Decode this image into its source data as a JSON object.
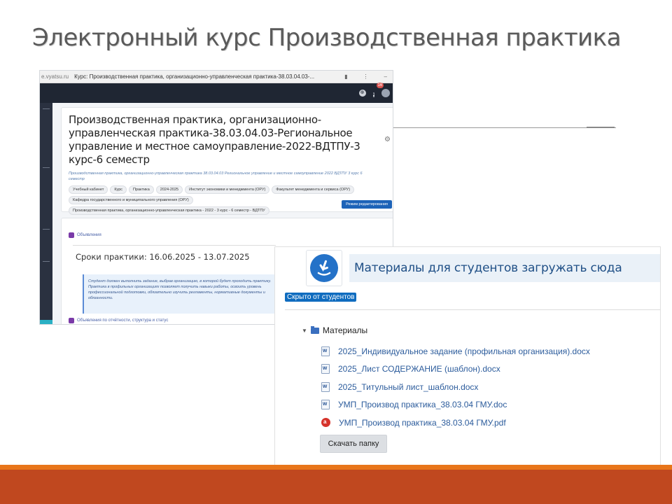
{
  "slide": {
    "title": "Электронный курс Производственная практика"
  },
  "browser": {
    "url": "e.vyatsu.ru",
    "tab_title": "Курс: Производственная практика, организационно-управленческая практика-38.03.04.03-...",
    "notification_count": "16"
  },
  "course": {
    "name": "Производственная практика, организационно-управленческая практика-38.03.04.03-Региональное управление и местное самоуправление-2022-ВДТПУ-3 курс-6 семестр",
    "subtitle": "Производственная практика, организационно-управленческая практика 38.03.04.03 Региональное управление и местное самоуправление 2022 ВДТПУ 3 курс 6 семестр",
    "chips": [
      "Учебный кабинет",
      "Курс",
      "Практика",
      "2024-2025",
      "Институт экономики и менеджмента (ОРУ)",
      "Факультет менеджмента и сервиса (ОРУ)",
      "Кафедра государственного и муниципального управления (ОРУ)",
      "Производственная практика, организационно-управленческая практика - 2022 - 3 курс - 6 семестр - ВДТПУ"
    ],
    "action_button": "Режим редактирования",
    "announcements_label": "Объявления",
    "dates_text": "Сроки практики: 16.06.2025 - 13.07.2025",
    "info_text": "Студент должен выполнить задание, выбрав организацию, в которой будет проходить практику. Практика в профильных организациях позволяет получить навыки работы, освоить уровень профессиональной подготовки, обязательно изучить регламенты, нормативные документы и обязанности.",
    "news_label": "Объявления по отчётности, структура и статус"
  },
  "materials": {
    "banner_text": "Материалы для студентов загружать сюда",
    "hidden_badge": "Скрыто от студентов",
    "folder_name": "Материалы",
    "files": [
      {
        "name": "2025_Индивидуальное задание (профильная организация).docx",
        "type": "docx"
      },
      {
        "name": "2025_Лист СОДЕРЖАНИЕ (шаблон).docx",
        "type": "docx"
      },
      {
        "name": "2025_Титульный лист_шаблон.docx",
        "type": "docx"
      },
      {
        "name": "УМП_Производ практика_38.03.04 ГМУ.doc",
        "type": "doc"
      },
      {
        "name": "УМП_Производ практика_38.03.04 ГМУ.pdf",
        "type": "pdf"
      }
    ],
    "download_button": "Скачать папку"
  },
  "colors": {
    "accent_orange": "#e8751a",
    "accent_red": "#c0481f",
    "moodle_blue": "#0f6cbf",
    "banner_bg": "#eaf1f8"
  }
}
